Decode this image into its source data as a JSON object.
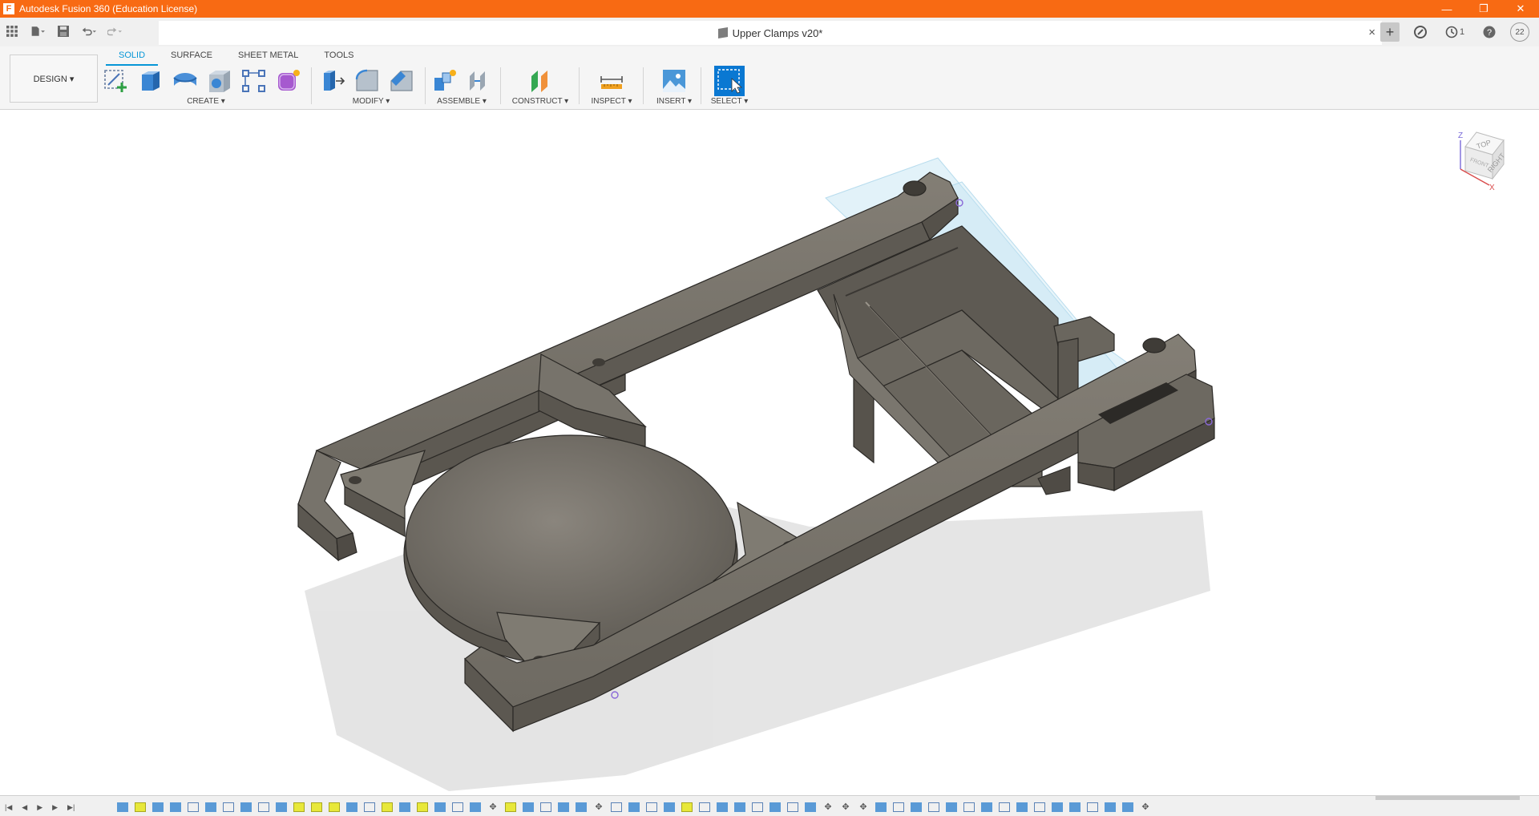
{
  "window": {
    "title": "Autodesk Fusion 360 (Education License)",
    "logo_letter": "F",
    "minimize": "—",
    "restore": "❐",
    "close": "✕"
  },
  "document": {
    "tab_title": "Upper Clamps v20*",
    "close_label": "×",
    "job_count": "1",
    "avatar_initials": "22"
  },
  "workspace": {
    "label": "DESIGN ▾"
  },
  "ribbon": {
    "tabs": [
      {
        "label": "SOLID",
        "active": true
      },
      {
        "label": "SURFACE"
      },
      {
        "label": "SHEET METAL"
      },
      {
        "label": "TOOLS"
      }
    ],
    "groups": {
      "create": "CREATE ▾",
      "modify": "MODIFY ▾",
      "assemble": "ASSEMBLE ▾",
      "construct": "CONSTRUCT ▾",
      "inspect": "INSPECT ▾",
      "insert": "INSERT ▾",
      "select": "SELECT ▾"
    }
  },
  "viewcube": {
    "top": "TOP",
    "right": "RIGHT",
    "front": "FRONT",
    "axis_z": "Z",
    "axis_x": "X"
  },
  "colors": {
    "titlebar": "#f86a13",
    "accent": "#0696d7",
    "model": "#7a766e"
  }
}
